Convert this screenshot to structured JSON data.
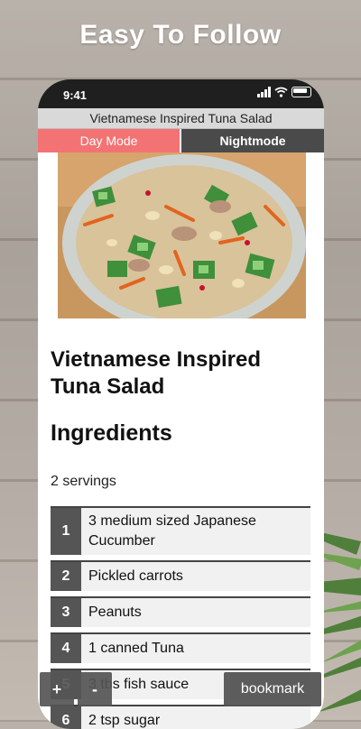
{
  "banner": {
    "text": "Easy To Follow"
  },
  "status_bar": {
    "time": "9:41"
  },
  "app": {
    "title": "Vietnamese Inspired Tuna Salad",
    "tabs": {
      "day": "Day Mode",
      "night": "Nightmode"
    },
    "accent_color": "#f37374"
  },
  "recipe": {
    "title": "Vietnamese Inspired Tuna Salad",
    "ingredients_heading": "Ingredients",
    "servings": "2 servings",
    "ingredients": [
      {
        "num": "1",
        "text": "3 medium sized Japanese Cucumber"
      },
      {
        "num": "2",
        "text": "Pickled carrots"
      },
      {
        "num": "3",
        "text": "Peanuts"
      },
      {
        "num": "4",
        "text": "1 canned Tuna"
      },
      {
        "num": "5",
        "text": "3 tbs fish sauce"
      },
      {
        "num": "6",
        "text": "2 tsp sugar"
      }
    ]
  },
  "controls": {
    "zoom_in": "+",
    "zoom_out": "-",
    "bookmark": "bookmark"
  }
}
